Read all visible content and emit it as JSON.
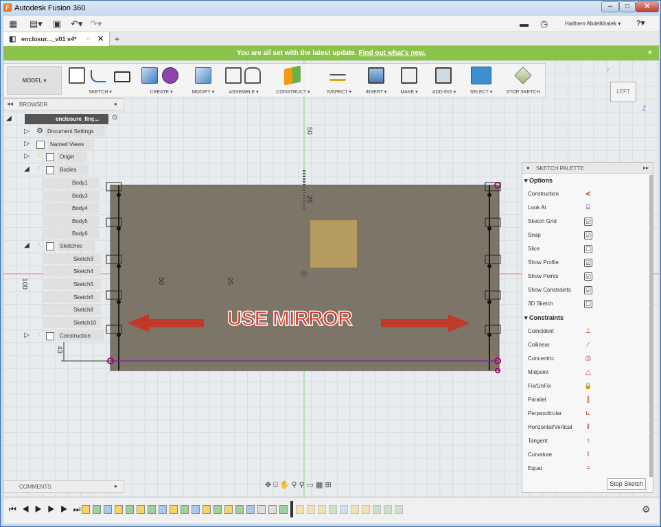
{
  "window": {
    "title": "Autodesk Fusion 360",
    "app_icon": "F"
  },
  "qat": {
    "user": "Haithem Abdelkhalek ▾",
    "help": "?▾"
  },
  "document_tab": {
    "name": "enclosur..._v01 v4*",
    "add": "+"
  },
  "banner": {
    "message": "You are all set with the latest update.",
    "link": "Find out what's new.",
    "close": "×"
  },
  "toolbar": {
    "mode": "MODEL ▾",
    "groups": [
      {
        "label": "SKETCH ▾"
      },
      {
        "label": "CREATE ▾"
      },
      {
        "label": "MODIFY ▾"
      },
      {
        "label": "ASSEMBLE ▾"
      },
      {
        "label": "CONSTRUCT ▾"
      },
      {
        "label": "INSPECT ▾"
      },
      {
        "label": "INSERT ▾"
      },
      {
        "label": "MAKE ▾"
      },
      {
        "label": "ADD-INS ▾"
      },
      {
        "label": "SELECT ▾"
      },
      {
        "label": "STOP SKETCH"
      }
    ]
  },
  "browser": {
    "header": "BROWSER",
    "root": "enclosure_finç...",
    "nodes": [
      {
        "label": "Document Settings"
      },
      {
        "label": "Named Views"
      },
      {
        "label": "Origin"
      },
      {
        "label": "Bodies"
      },
      {
        "label": "Body1"
      },
      {
        "label": "Body3"
      },
      {
        "label": "Body4"
      },
      {
        "label": "Body5"
      },
      {
        "label": "Body6"
      },
      {
        "label": "Sketches"
      },
      {
        "label": "Sketch3"
      },
      {
        "label": "Sketch4"
      },
      {
        "label": "Sketch5"
      },
      {
        "label": "Sketch6"
      },
      {
        "label": "Sketch8"
      },
      {
        "label": "Sketch10"
      },
      {
        "label": "Construction"
      }
    ]
  },
  "comments": {
    "label": "COMMENTS"
  },
  "viewcube": {
    "face": "LEFT",
    "axis_y": "Y",
    "axis_z": "Z"
  },
  "canvas": {
    "annotation": "USE MIRROR",
    "dims": {
      "top": "50",
      "small": "25",
      "left_50": "50",
      "left_25": "25",
      "left_100": "100",
      "bottom": "43"
    },
    "colors": {
      "body": "#7d7568",
      "annotation": "#d93a2b",
      "arrow": "#c0392b"
    }
  },
  "palette": {
    "title": "SKETCH PALETTE",
    "options_header": "Options",
    "options": [
      {
        "label": "Construction",
        "icon": "construction-icon"
      },
      {
        "label": "Look At",
        "icon": "look-at-icon"
      },
      {
        "label": "Sketch Grid",
        "state": "☑"
      },
      {
        "label": "Snap",
        "state": "☑"
      },
      {
        "label": "Slice",
        "state": "☐"
      },
      {
        "label": "Show Profile",
        "state": "☑"
      },
      {
        "label": "Show Points",
        "state": "☑"
      },
      {
        "label": "Show Constraints",
        "state": "☑"
      },
      {
        "label": "3D Sketch",
        "state": "☐"
      }
    ],
    "constraints_header": "Constraints",
    "constraints": [
      {
        "label": "Coincident",
        "glyph": "⊥"
      },
      {
        "label": "Collinear",
        "glyph": "⁄"
      },
      {
        "label": "Concentric",
        "glyph": "◎"
      },
      {
        "label": "Midpoint",
        "glyph": "△"
      },
      {
        "label": "Fix/UnFix",
        "glyph": "🔒"
      },
      {
        "label": "Parallel",
        "glyph": "∥"
      },
      {
        "label": "Perpendicular",
        "glyph": "⊾"
      },
      {
        "label": "Horizontal/Vertical",
        "glyph": "‖"
      },
      {
        "label": "Tangent",
        "glyph": "♁"
      },
      {
        "label": "Curvature",
        "glyph": "⌇"
      },
      {
        "label": "Equal",
        "glyph": "="
      }
    ],
    "stop_button": "Stop Sketch"
  }
}
